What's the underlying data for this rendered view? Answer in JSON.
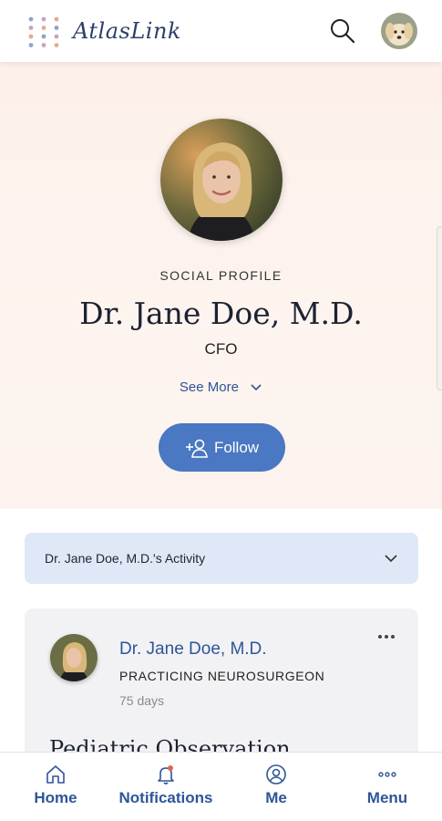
{
  "header": {
    "app_name": "AtlasLink",
    "logo_dot_colors": [
      "#8fa3c9",
      "#c9a3c0",
      "#e8a98d"
    ],
    "search_icon": "search-icon",
    "avatar": "dog-avatar"
  },
  "profile": {
    "label": "SOCIAL PROFILE",
    "name": "Dr. Jane Doe, M.D.",
    "title": "CFO",
    "see_more": "See More",
    "follow": "Follow"
  },
  "activity": {
    "label": "Dr. Jane Doe, M.D.'s Activity"
  },
  "post": {
    "author": "Dr. Jane Doe, M.D.",
    "role": "PRACTICING NEUROSURGEON",
    "time": "75 days",
    "title": "Pediatric Observation"
  },
  "nav": {
    "home": "Home",
    "notifications": "Notifications",
    "me": "Me",
    "menu": "Menu"
  },
  "colors": {
    "accent": "#4a78c2",
    "link": "#2f5597",
    "notification_dot": "#e0664a"
  }
}
